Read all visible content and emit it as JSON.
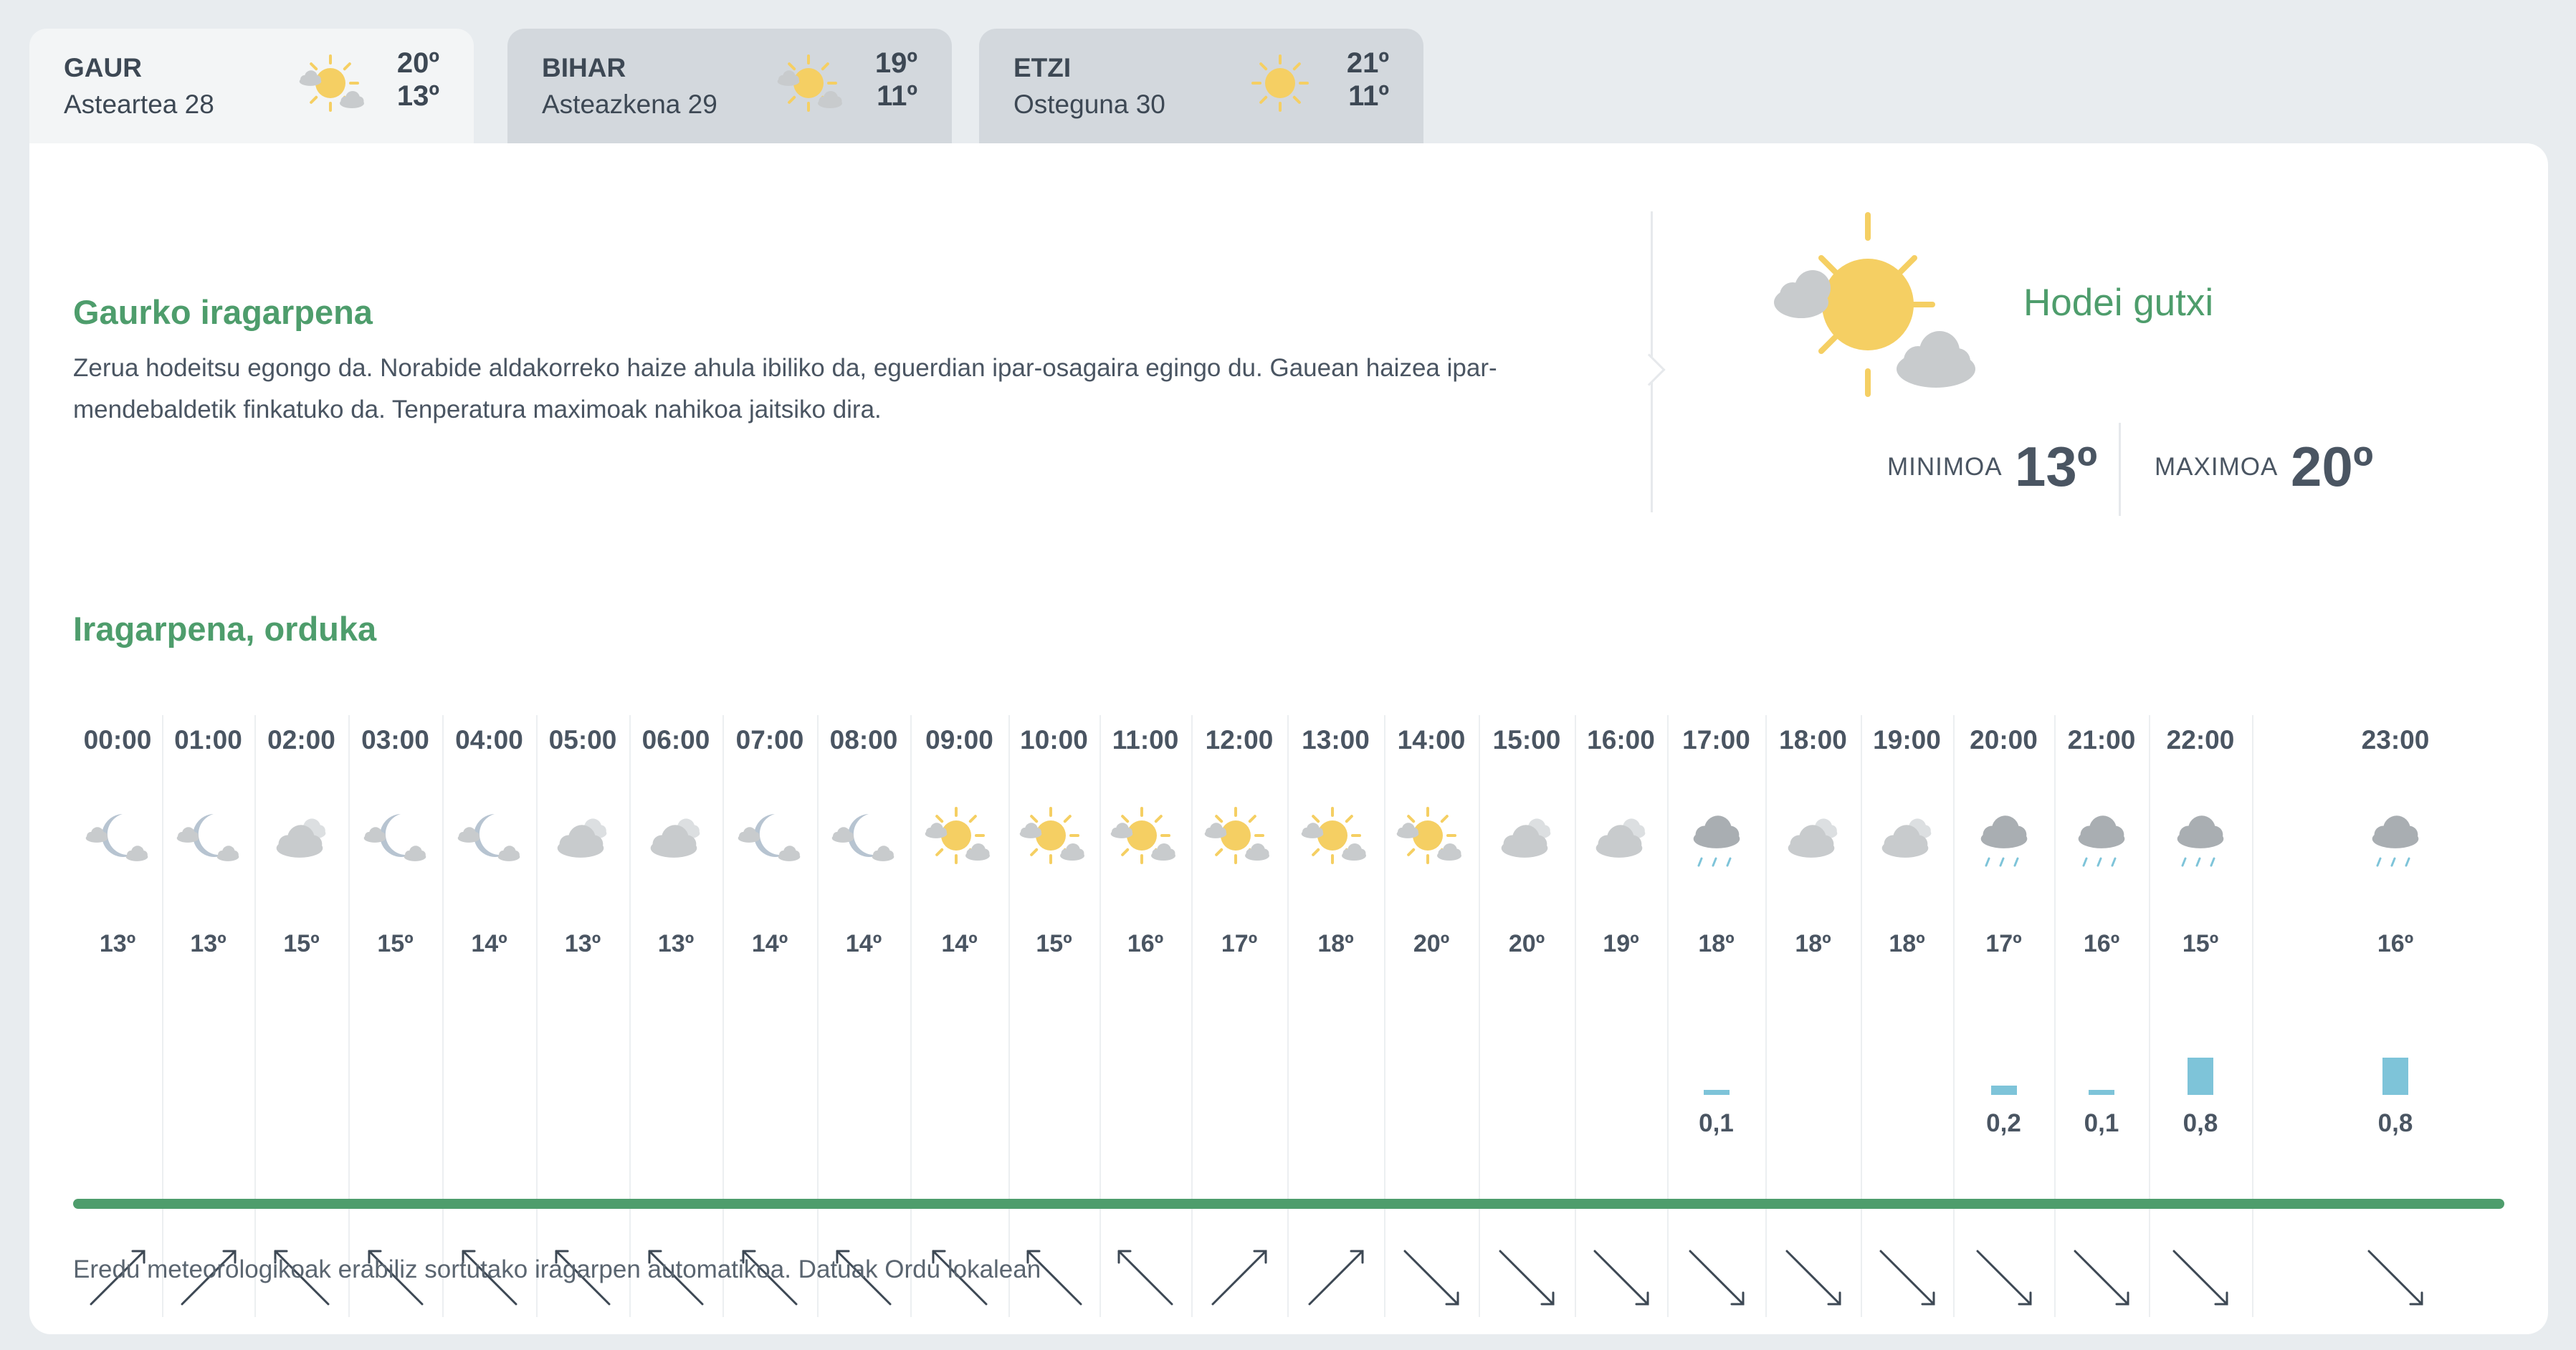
{
  "tabs": [
    {
      "name": "GAUR",
      "date": "Asteartea 28",
      "max": "20º",
      "min": "13º",
      "icon": "sun-cloud-icon",
      "active": true
    },
    {
      "name": "BIHAR",
      "date": "Asteazkena 29",
      "max": "19º",
      "min": "11º",
      "icon": "sun-cloud-icon",
      "active": false
    },
    {
      "name": "ETZI",
      "date": "Osteguna 30",
      "max": "21º",
      "min": "11º",
      "icon": "sun-icon",
      "active": false
    }
  ],
  "today": {
    "title": "Gaurko iragarpena",
    "text": "Zerua hodeitsu egongo da. Norabide aldakorreko haize ahula ibiliko da, eguerdian ipar-osagaira egingo du. Gauean haizea ipar-mendebaldetik finkatuko da. Tenperatura maximoak nahikoa jaitsiko dira.",
    "sky": "Hodei gutxi",
    "min_label": "MINIMOA",
    "min_value": "13º",
    "max_label": "MAXIMOA",
    "max_value": "20º"
  },
  "hourly": {
    "title": "Iragarpena, orduka",
    "hours": [
      {
        "time": "00:00",
        "icon": "moon-cloud-icon",
        "temp": "13º",
        "rain": "",
        "rain_amount": 0,
        "wind": "up-right"
      },
      {
        "time": "01:00",
        "icon": "moon-cloud-icon",
        "temp": "13º",
        "rain": "",
        "rain_amount": 0,
        "wind": "up-right"
      },
      {
        "time": "02:00",
        "icon": "cloud-icon",
        "temp": "15º",
        "rain": "",
        "rain_amount": 0,
        "wind": "down-right"
      },
      {
        "time": "03:00",
        "icon": "moon-cloud-icon",
        "temp": "15º",
        "rain": "",
        "rain_amount": 0,
        "wind": "down-right"
      },
      {
        "time": "04:00",
        "icon": "moon-cloud-icon",
        "temp": "14º",
        "rain": "",
        "rain_amount": 0,
        "wind": "down-right"
      },
      {
        "time": "05:00",
        "icon": "cloud-icon",
        "temp": "13º",
        "rain": "",
        "rain_amount": 0,
        "wind": "down-right"
      },
      {
        "time": "06:00",
        "icon": "cloud-icon",
        "temp": "13º",
        "rain": "",
        "rain_amount": 0,
        "wind": "down-right"
      },
      {
        "time": "07:00",
        "icon": "moon-cloud-icon",
        "temp": "14º",
        "rain": "",
        "rain_amount": 0,
        "wind": "down-right"
      },
      {
        "time": "08:00",
        "icon": "moon-cloud-icon",
        "temp": "14º",
        "rain": "",
        "rain_amount": 0,
        "wind": "down-right"
      },
      {
        "time": "09:00",
        "icon": "sun-cloud-icon",
        "temp": "14º",
        "rain": "",
        "rain_amount": 0,
        "wind": "down-right"
      },
      {
        "time": "10:00",
        "icon": "sun-cloud-icon",
        "temp": "15º",
        "rain": "",
        "rain_amount": 0,
        "wind": "down-right"
      },
      {
        "time": "11:00",
        "icon": "sun-cloud-icon",
        "temp": "16º",
        "rain": "",
        "rain_amount": 0,
        "wind": "down-right"
      },
      {
        "time": "12:00",
        "icon": "sun-cloud-icon",
        "temp": "17º",
        "rain": "",
        "rain_amount": 0,
        "wind": "up-right"
      },
      {
        "time": "13:00",
        "icon": "sun-cloud-icon",
        "temp": "18º",
        "rain": "",
        "rain_amount": 0,
        "wind": "up-right"
      },
      {
        "time": "14:00",
        "icon": "sun-cloud-icon",
        "temp": "20º",
        "rain": "",
        "rain_amount": 0,
        "wind": "down-right-arrow"
      },
      {
        "time": "15:00",
        "icon": "cloud-icon",
        "temp": "20º",
        "rain": "",
        "rain_amount": 0,
        "wind": "down-right-arrow"
      },
      {
        "time": "16:00",
        "icon": "cloud-icon",
        "temp": "19º",
        "rain": "",
        "rain_amount": 0,
        "wind": "down-right-arrow"
      },
      {
        "time": "17:00",
        "icon": "rain-cloud-icon",
        "temp": "18º",
        "rain": "0,1",
        "rain_amount": 0.1,
        "wind": "down-right-arrow"
      },
      {
        "time": "18:00",
        "icon": "cloud-icon",
        "temp": "18º",
        "rain": "",
        "rain_amount": 0,
        "wind": "down-right-arrow"
      },
      {
        "time": "19:00",
        "icon": "cloud-icon",
        "temp": "18º",
        "rain": "",
        "rain_amount": 0,
        "wind": "down-right-arrow"
      },
      {
        "time": "20:00",
        "icon": "rain-cloud-icon",
        "temp": "17º",
        "rain": "0,2",
        "rain_amount": 0.2,
        "wind": "down-right-arrow"
      },
      {
        "time": "21:00",
        "icon": "rain-cloud-icon",
        "temp": "16º",
        "rain": "0,1",
        "rain_amount": 0.1,
        "wind": "down-right-arrow"
      },
      {
        "time": "22:00",
        "icon": "rain-cloud-icon",
        "temp": "15º",
        "rain": "0,8",
        "rain_amount": 0.8,
        "wind": "down-right-arrow"
      },
      {
        "time": "23:00",
        "icon": "rain-cloud-icon",
        "temp": "16º",
        "rain": "0,8",
        "rain_amount": 0.8,
        "wind": "down-right-arrow"
      }
    ]
  },
  "footer": "Eredu meteorologikoak erabiliz sortutako iragarpen automatikoa. Datuak Ordu lokalean",
  "colors": {
    "accent": "#4e9d6c",
    "sun": "#f5cf63",
    "cloud": "#c8cbcd",
    "moon": "#b7c4d1",
    "rain": "#7ec4d9",
    "wind": "#3d4854"
  }
}
